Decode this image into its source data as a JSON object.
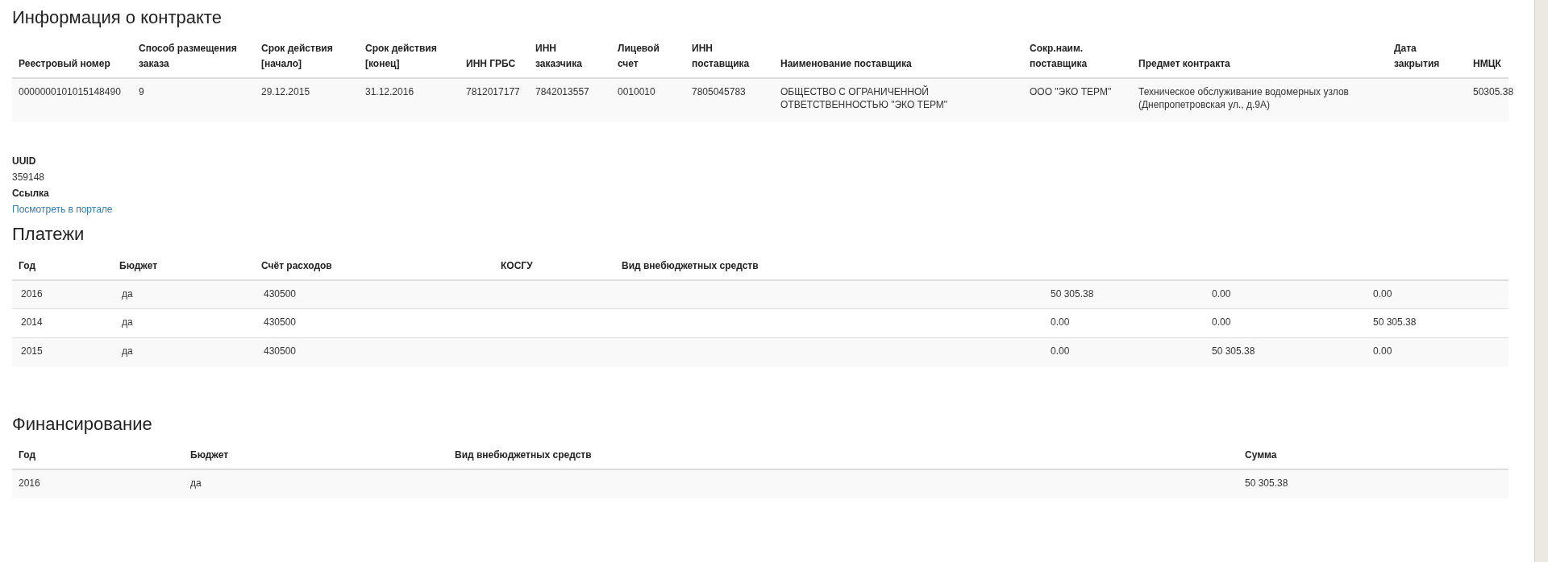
{
  "contract": {
    "title": "Информация о контракте",
    "table": {
      "columns": [
        "Реестровый номер",
        "Способ размещения заказа",
        "Срок действия [начало]",
        "Срок действия [конец]",
        "ИНН ГРБС",
        "ИНН заказчика",
        "Лицевой счет",
        "ИНН поставщика",
        "Наименование поставщика",
        "Сокр.наим. поставщика",
        "Предмет контракта",
        "Дата закрытия",
        "НМЦК"
      ],
      "rows": [
        {
          "registry_number": "0000000101015148490",
          "placement_method": "9",
          "start_date": "29.12.2015",
          "end_date": "31.12.2016",
          "grbs_inn": "7812017177",
          "customer_inn": "7842013557",
          "account": "0010010",
          "supplier_inn": "7805045783",
          "supplier_name": "ОБЩЕСТВО С ОГРАНИЧЕННОЙ ОТВЕТСТВЕННОСТЬЮ \"ЭКО ТЕРМ\"",
          "supplier_short_name": "ООО \"ЭКО ТЕРМ\"",
          "subject": "Техническое обслуживание водомерных узлов (Днепропетровская ул., д.9А)",
          "nmck": "50305.38"
        }
      ]
    }
  },
  "details": {
    "uuid_label": "UUID",
    "uuid_value": "359148",
    "link_label": "Ссылка",
    "link_text": "Посмотреть в портале"
  },
  "payments": {
    "title": "Платежи",
    "table": {
      "columns": [
        "Год",
        "Бюджет",
        "Счёт расходов",
        "КОСГУ",
        "Вид внебюджетных средств"
      ],
      "rows": [
        {
          "year": "2016",
          "budget": "да",
          "account": "430500",
          "column_6": "50 305.38",
          "column_7": "0.00",
          "column_8": "0.00"
        },
        {
          "year": "2014",
          "budget": "да",
          "account": "430500",
          "column_6": "0.00",
          "column_7": "0.00",
          "column_8": "50 305.38"
        },
        {
          "year": "2015",
          "budget": "да",
          "account": "430500",
          "column_6": "0.00",
          "column_7": "50 305.38",
          "column_8": "0.00"
        }
      ]
    }
  },
  "financing": {
    "title": "Финансирование",
    "table": {
      "columns": [
        "Год",
        "Бюджет",
        "Вид внебюджетных средств",
        "Сумма"
      ],
      "rows": [
        {
          "year": "2016",
          "budget": "да",
          "amount": "50 305.38"
        }
      ]
    }
  }
}
